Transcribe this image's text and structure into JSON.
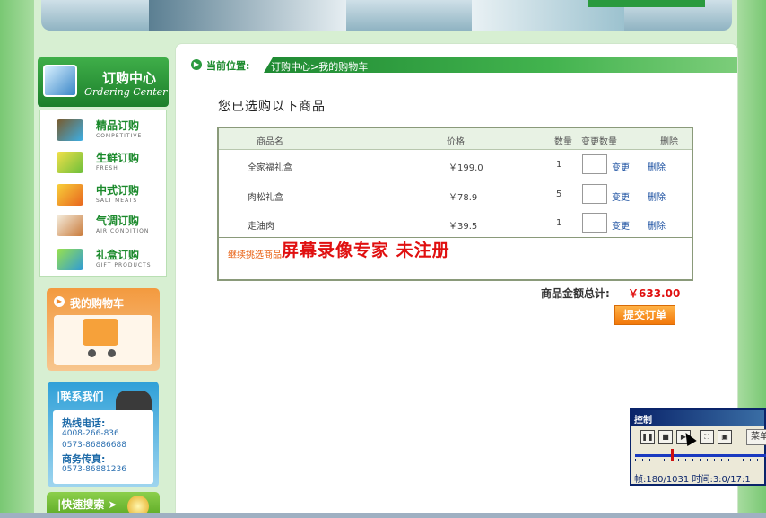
{
  "sidebar": {
    "ordering_cn": "订购中心",
    "ordering_en": "Ordering Center",
    "menu": [
      {
        "cn": "精品订购",
        "en": "COMPETITIVE",
        "icon": "competitive-icon"
      },
      {
        "cn": "生鲜订购",
        "en": "FRESH",
        "icon": "fresh-icon"
      },
      {
        "cn": "中式订购",
        "en": "SALT MEATS",
        "icon": "salt-meats-icon"
      },
      {
        "cn": "气调订购",
        "en": "AIR CONDITION",
        "icon": "air-condition-icon"
      },
      {
        "cn": "礼盒订购",
        "en": "GIFT PRODUCTS",
        "icon": "gift-products-icon"
      }
    ],
    "cart_title": "我的购物车",
    "contact_title": "|联系我们",
    "hotline_label": "热线电话:",
    "hotline_1": "4008-266-836",
    "hotline_2": "0573-86886688",
    "fax_label": "商务传真:",
    "fax": "0573-86881236",
    "search_title": "|快速搜索 ➤"
  },
  "breadcrumb": {
    "label": "当前位置:",
    "path": "订购中心>我的购物车"
  },
  "main": {
    "heading": "您已选购以下商品",
    "columns": {
      "name": "商品名",
      "price": "价格",
      "qty": "数量",
      "change_qty": "变更数量",
      "delete": "删除"
    },
    "rows": [
      {
        "name": "全家福礼盒",
        "price": "￥199.0",
        "qty": "1",
        "change": "变更",
        "delete": "删除"
      },
      {
        "name": "肉松礼盒",
        "price": "￥78.9",
        "qty": "5",
        "change": "变更",
        "delete": "删除"
      },
      {
        "name": "走油肉",
        "price": "￥39.5",
        "qty": "1",
        "change": "变更",
        "delete": "删除"
      }
    ],
    "continue_link": "继续挑选商品",
    "watermark": "屏幕录像专家 未注册",
    "total_label": "商品金额总计:",
    "total_value": "￥633.00",
    "submit_label": "提交订单"
  },
  "control_window": {
    "title": "控制",
    "menu_label": "菜单",
    "status": "帧:180/1031 时间:3:0/17:1"
  },
  "colors": {
    "brand_green": "#1b8a2c",
    "price_red": "#e01010",
    "orange": "#f2780a"
  }
}
